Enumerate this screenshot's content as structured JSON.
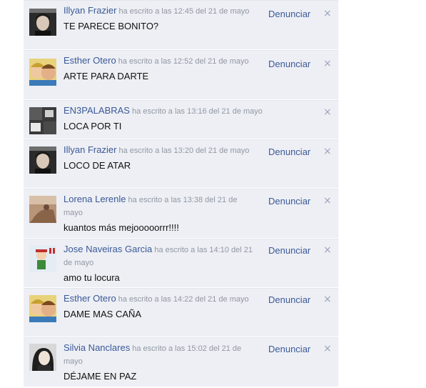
{
  "report_label": "Denunciar",
  "close_glyph": "×",
  "comments": [
    {
      "author": "Illyan Frazier",
      "time_prefix": "ha escrito a las",
      "time": "12:45",
      "date": "del 21 de mayo",
      "text": "TE PARECE BONITO?",
      "avatar": "avatar-illyan"
    },
    {
      "author": "Esther Otero",
      "time_prefix": "ha escrito a las",
      "time": "12:52",
      "date": "del 21 de mayo",
      "text": "ARTE PARA DARTE",
      "avatar": "avatar-esther"
    },
    {
      "author": "EN3PALABRAS",
      "time_prefix": "ha escrito a las",
      "time": "13:16",
      "date": "del 21 de mayo",
      "text": "LOCA POR TI",
      "avatar": "avatar-en3palabras"
    },
    {
      "author": "Illyan Frazier",
      "time_prefix": "ha escrito a las",
      "time": "13:20",
      "date": "del 21 de mayo",
      "text": "LOCO DE ATAR",
      "avatar": "avatar-illyan"
    },
    {
      "author": "Lorena Lerenle",
      "time_prefix": "ha escrito a las",
      "time": "13:38",
      "date": "del 21 de mayo",
      "text": "kuantos más mejooooorrr!!!!",
      "avatar": "avatar-lorena"
    },
    {
      "author": "Jose Naveiras Garcia",
      "time_prefix": "ha escrito a las",
      "time": "14:10",
      "date": "del 21 de mayo",
      "text": "amo tu locura",
      "avatar": "avatar-jose"
    },
    {
      "author": "Esther Otero",
      "time_prefix": "ha escrito a las",
      "time": "14:22",
      "date": "del 21 de mayo",
      "text": "DAME MAS CAÑA",
      "avatar": "avatar-esther"
    },
    {
      "author": "Silvia Nanclares",
      "time_prefix": "ha escrito a las",
      "time": "15:02",
      "date": "del 21 de mayo",
      "text": "DÉJAME EN PAZ",
      "avatar": "avatar-silvia"
    }
  ]
}
